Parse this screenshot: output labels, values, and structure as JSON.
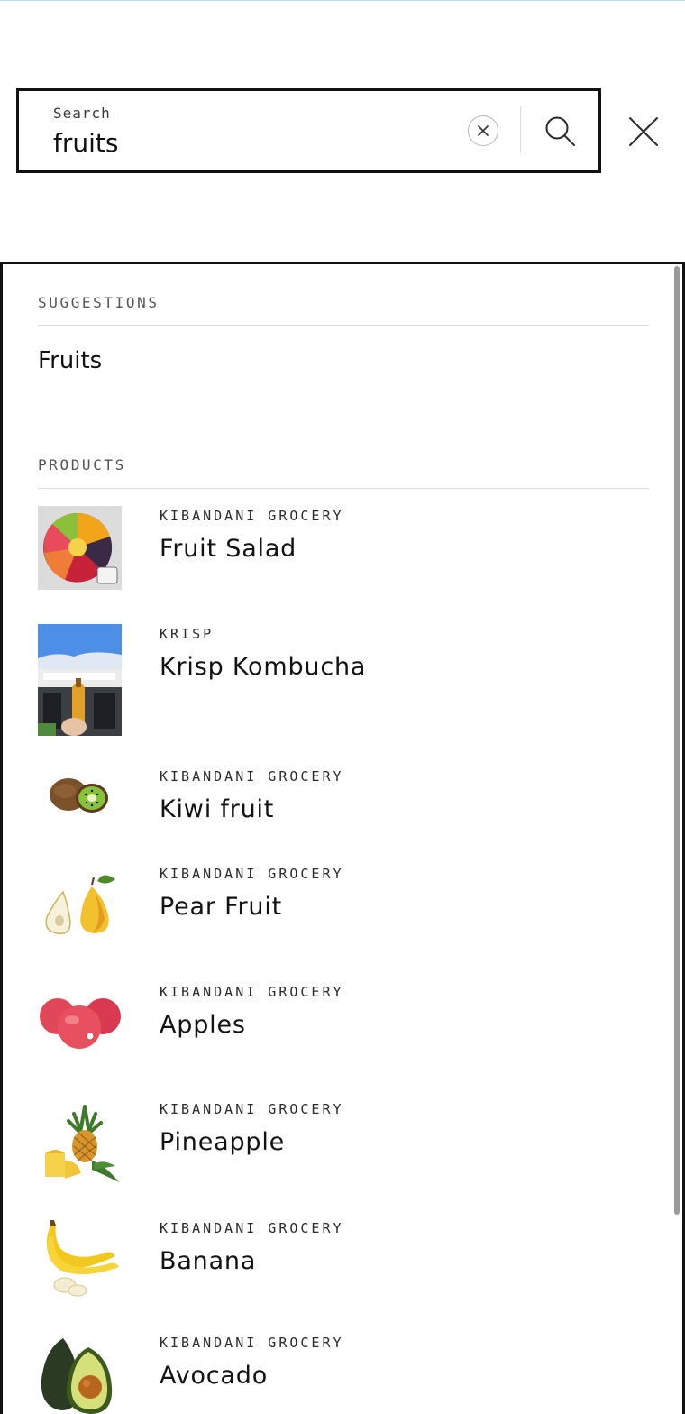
{
  "search": {
    "label": "Search",
    "value": "fruits"
  },
  "icons": {
    "clear": "clear-circle-x-icon",
    "search": "magnifier-icon",
    "close": "close-x-icon"
  },
  "suggestions": {
    "heading": "SUGGESTIONS",
    "items": [
      {
        "label": "Fruits"
      }
    ]
  },
  "products": {
    "heading": "PRODUCTS",
    "items": [
      {
        "vendor": "KIBANDANI GROCERY",
        "title": "Fruit Salad"
      },
      {
        "vendor": "KRISP",
        "title": "Krisp Kombucha"
      },
      {
        "vendor": "KIBANDANI GROCERY",
        "title": "Kiwi fruit"
      },
      {
        "vendor": "KIBANDANI GROCERY",
        "title": "Pear Fruit"
      },
      {
        "vendor": "KIBANDANI GROCERY",
        "title": "Apples"
      },
      {
        "vendor": "KIBANDANI GROCERY",
        "title": "Pineapple"
      },
      {
        "vendor": "KIBANDANI GROCERY",
        "title": "Banana"
      },
      {
        "vendor": "KIBANDANI GROCERY",
        "title": "Avocado"
      }
    ]
  }
}
